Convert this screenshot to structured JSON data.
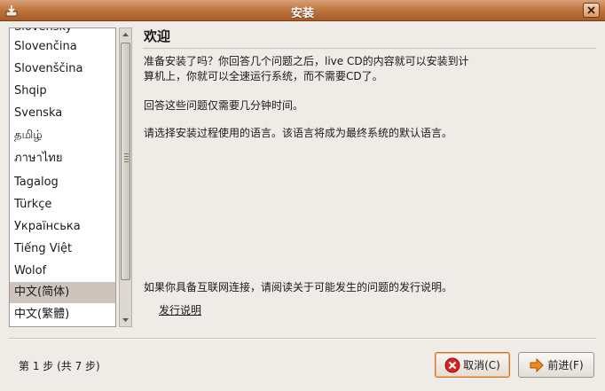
{
  "window": {
    "title": "安装"
  },
  "languages": {
    "items": [
      "Slovenčina",
      "Slovenščina",
      "Shqip",
      "Svenska",
      "தமிழ்",
      "ภาษาไทย",
      "Tagalog",
      "Türkçe",
      "Українська",
      "Tiếng Việt",
      "Wolof",
      "中文(简体)",
      "中文(繁體)"
    ],
    "selected": "中文(简体)"
  },
  "welcome": {
    "title": "欢迎",
    "para1_line1": "准备安装了吗？你回答几个问题之后，live CD的内容就可以安装到计",
    "para1_line2": "算机上，你就可以全速运行系统，而不需要CD了。",
    "para2": "回答这些问题仅需要几分钟时间。",
    "para3": "请选择安装过程使用的语言。该语言将成为最终系统的默认语言。",
    "para4": "如果你具备互联网连接，请阅读关于可能发生的问题的发行说明。",
    "release_notes_link": "发行说明"
  },
  "footer": {
    "step_text": "第 1 步 (共 7 步)",
    "cancel_label": "取消(C)",
    "forward_label": "前进(F)"
  },
  "icons": {
    "app": "installer-icon",
    "close": "close-icon",
    "cancel": "cancel-icon",
    "forward": "forward-arrow-icon"
  },
  "colors": {
    "titlebar": "#b86a33",
    "selection": "#cdc5bd",
    "focus_border": "#d17424",
    "cancel_icon": "#d8231f",
    "forward_icon": "#f28a1c"
  }
}
